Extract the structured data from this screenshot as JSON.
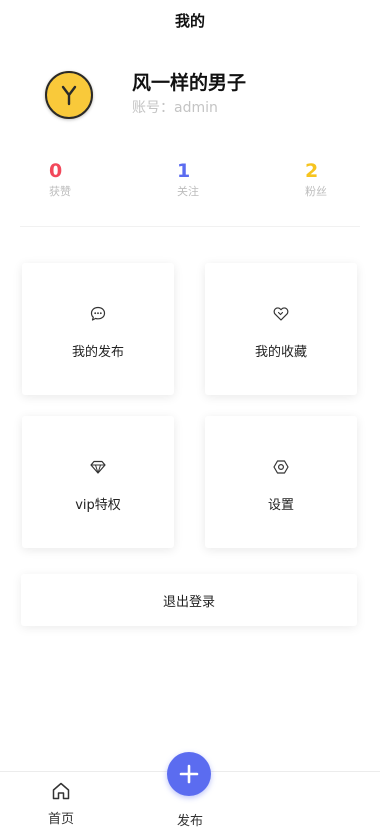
{
  "header": {
    "title": "我的"
  },
  "profile": {
    "username": "风一样的男子",
    "account": "账号：admin"
  },
  "stats": [
    {
      "value": "0",
      "label": "获赞",
      "color": "#f2485b"
    },
    {
      "value": "1",
      "label": "关注",
      "color": "#5b6cf0"
    },
    {
      "value": "2",
      "label": "粉丝",
      "color": "#f6c41f"
    }
  ],
  "menu": [
    {
      "label": "我的发布",
      "icon": "chat-bubble-icon"
    },
    {
      "label": "我的收藏",
      "icon": "heart-icon"
    },
    {
      "label": "vip特权",
      "icon": "diamond-icon"
    },
    {
      "label": "设置",
      "icon": "settings-icon"
    }
  ],
  "logout": {
    "label": "退出登录"
  },
  "tabbar": {
    "home_label": "首页",
    "publish_label": "发布"
  },
  "colors": {
    "accent": "#5b6cf0",
    "avatar": "#f9c93a"
  }
}
